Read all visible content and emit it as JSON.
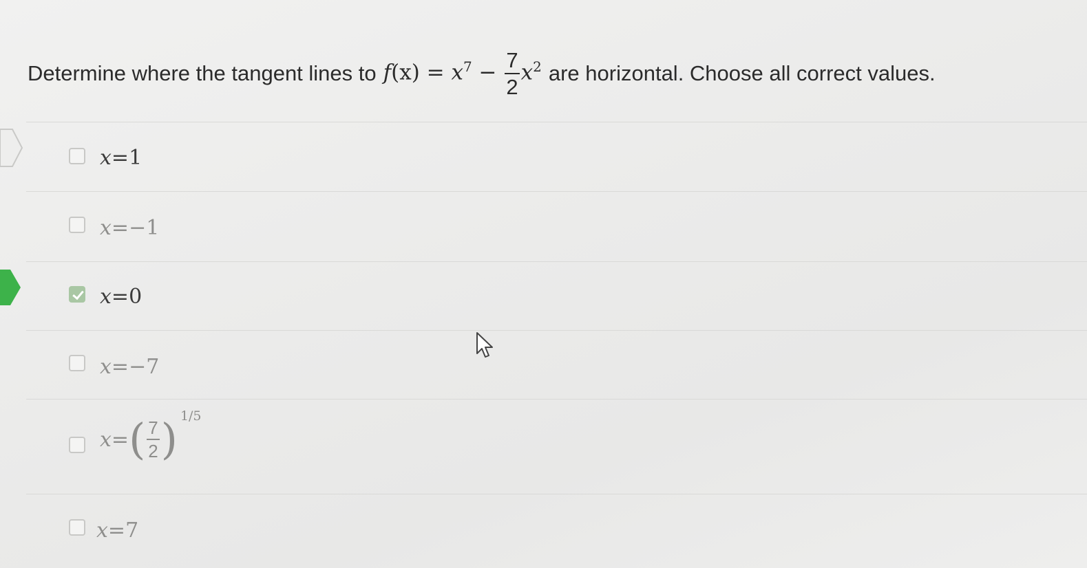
{
  "question": {
    "prefix": "Determine where the tangent lines to ",
    "func_name": "f",
    "func_var": "(x)",
    "equals": " = ",
    "base": "x",
    "power": "7",
    "minus": " − ",
    "frac_num": "7",
    "frac_den": "2",
    "base2": "x",
    "power2": "2",
    "suffix": "are horizontal. Choose all correct values."
  },
  "options": [
    {
      "lhs": "x",
      "eq": " = ",
      "rhs": "1",
      "checked": false
    },
    {
      "lhs": "x",
      "eq": " = ",
      "rhs": "−1",
      "checked": false
    },
    {
      "lhs": "x",
      "eq": " = ",
      "rhs": "0",
      "checked": true
    },
    {
      "lhs": "x",
      "eq": " = ",
      "rhs": "−7",
      "checked": false
    },
    {
      "lhs": "x",
      "eq": " = ",
      "frac_num": "7",
      "frac_den": "2",
      "exponent": "1/5",
      "checked": false
    },
    {
      "lhs": "x",
      "eq": " = ",
      "rhs": "7",
      "checked": false
    }
  ],
  "colors": {
    "correct_marker": "#3db24a",
    "checked_box": "#a9c7a4",
    "text": "#2b2b2b"
  },
  "icons": {
    "cursor": "arrow-cursor-icon",
    "selection_marker": "chevron-marker-icon"
  }
}
